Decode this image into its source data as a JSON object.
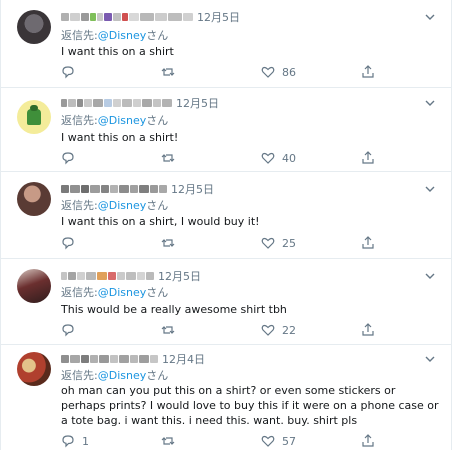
{
  "reply_prefix": "返信先:",
  "reply_suffix": "さん",
  "icons": [
    "chevron-down-icon",
    "reply-icon",
    "retweet-icon",
    "like-icon",
    "share-icon"
  ],
  "colors": {
    "link": "#1b95e0",
    "muted": "#657786",
    "text": "#14171a",
    "divider": "#e6ecf0"
  },
  "tweets": [
    {
      "date": "12月5日",
      "handle": "@Disney",
      "text": "I want this on a shirt",
      "likes": "86",
      "replies": ""
    },
    {
      "date": "12月5日",
      "handle": "@Disney",
      "text": "I want this on a shirt!",
      "likes": "40",
      "replies": ""
    },
    {
      "date": "12月5日",
      "handle": "@Disney",
      "text": "I want this on a shirt, I would buy it!",
      "likes": "25",
      "replies": ""
    },
    {
      "date": "12月5日",
      "handle": "@Disney",
      "text": "This would be a really awesome shirt tbh",
      "likes": "22",
      "replies": ""
    },
    {
      "date": "12月4日",
      "handle": "@Disney",
      "text": "oh man can you put this on a shirt? or even some stickers or perhaps prints? I would love to buy  this if it were on a phone case or a tote bag. i want this. i need this. want. buy. shirt pls",
      "likes": "57",
      "replies": "1"
    }
  ]
}
